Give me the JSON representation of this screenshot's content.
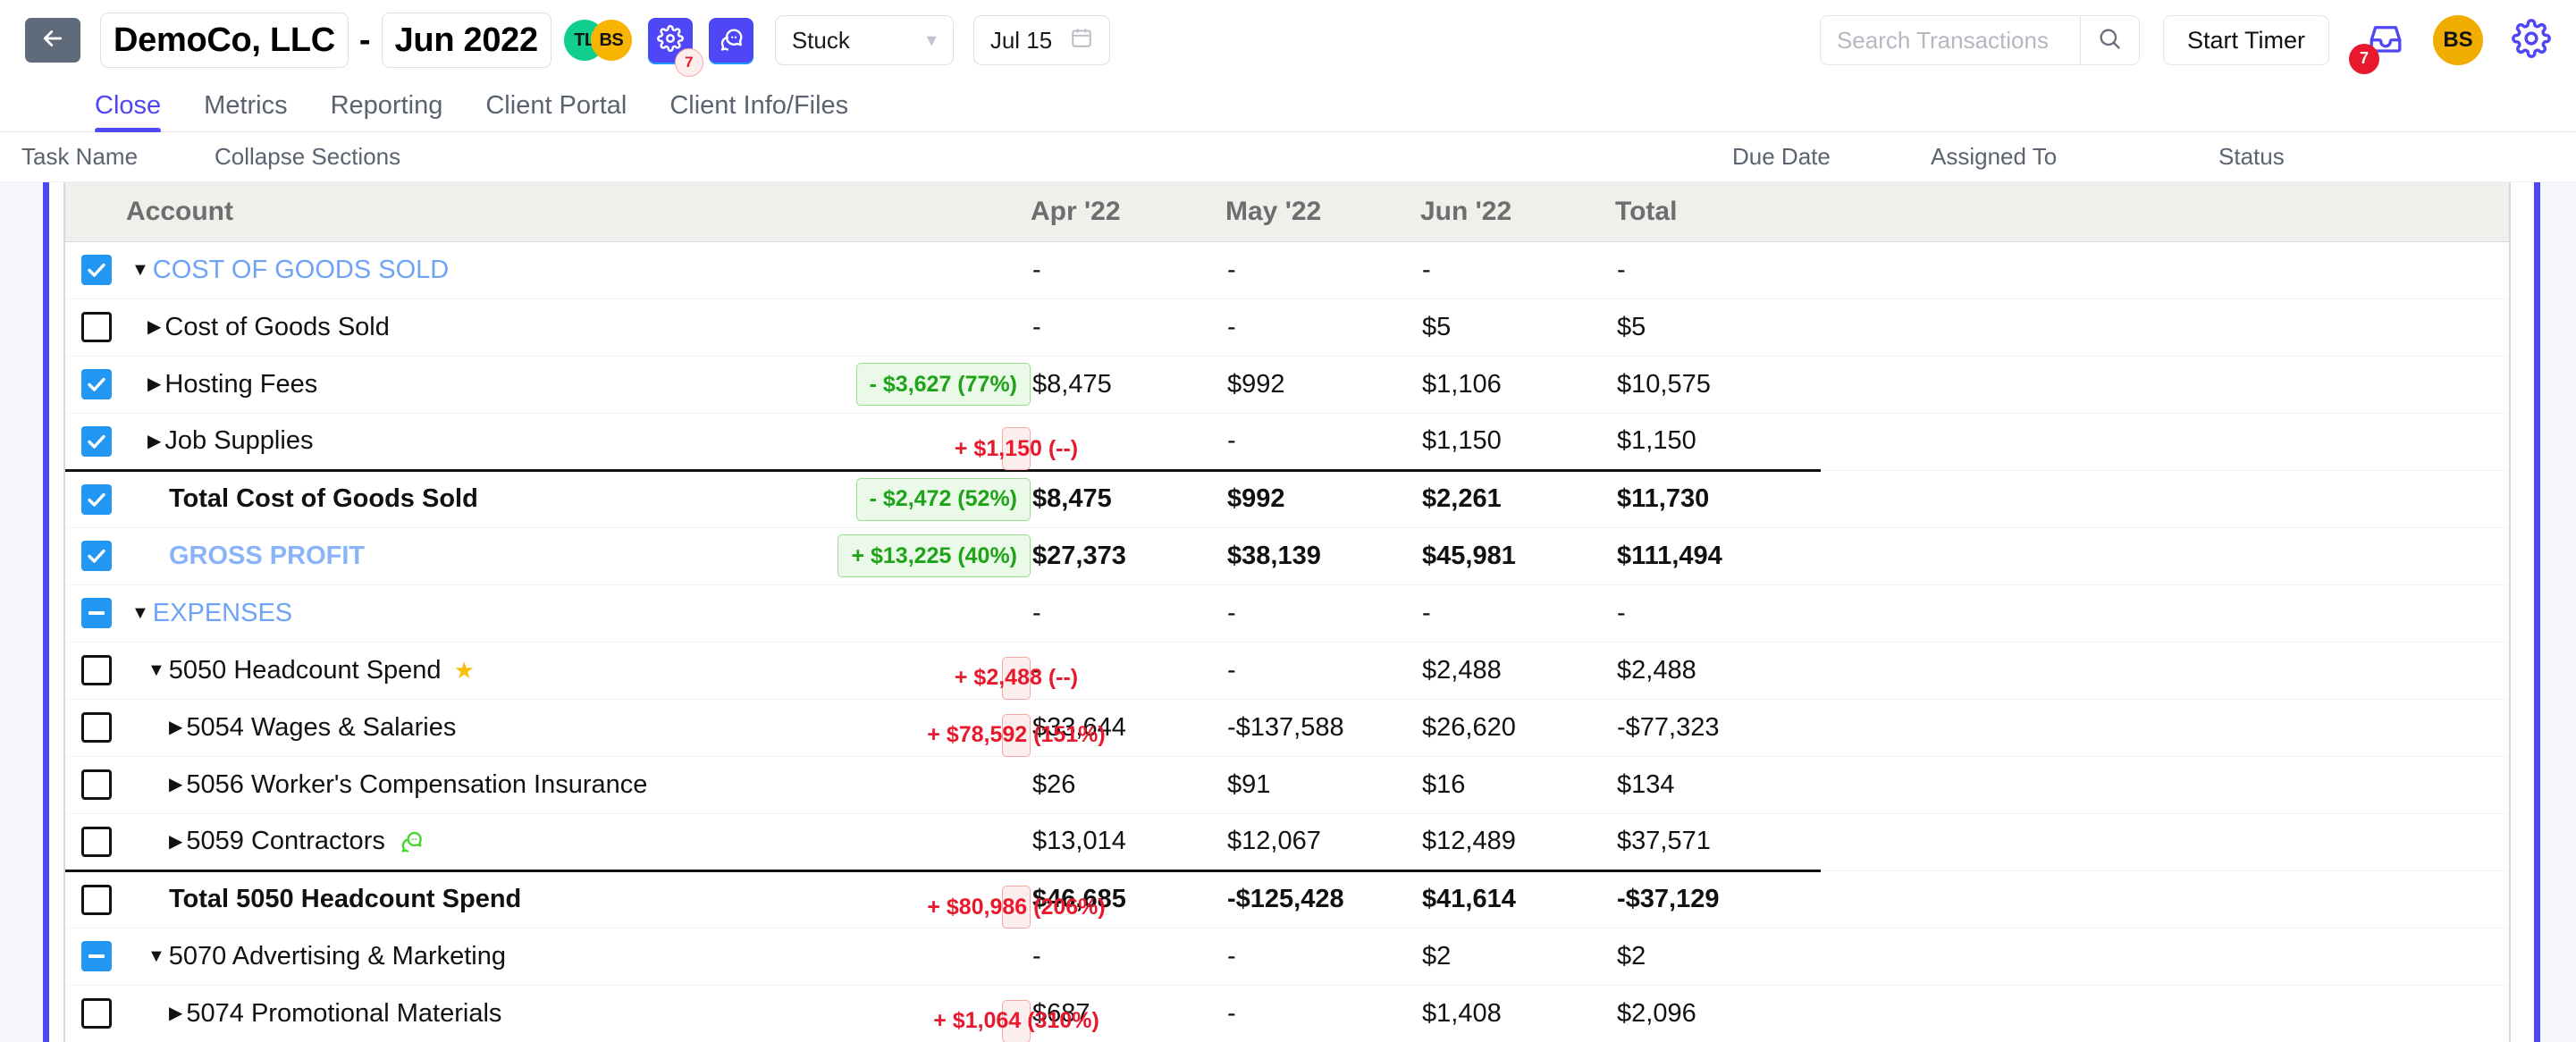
{
  "header": {
    "back_icon": "arrow-left-icon",
    "client_name": "DemoCo, LLC",
    "separator": "-",
    "period": "Jun 2022",
    "avatar_team": "TL",
    "avatar_team2": "BS",
    "gear_icon": "gear-icon",
    "chat_icon": "chat-bubble-icon",
    "chat_badge": "7",
    "status_select": "Stuck",
    "status_caret": "chevron-down-icon",
    "date_value": "Jul 15",
    "calendar_icon": "calendar-icon",
    "search_placeholder": "Search Transactions",
    "search_value": "",
    "search_icon": "search-icon",
    "start_timer": "Start Timer",
    "inbox_icon": "inbox-icon",
    "inbox_badge": "7",
    "user_avatar": "BS",
    "settings_icon": "gear-icon"
  },
  "tabs": [
    {
      "label": "Close",
      "active": true
    },
    {
      "label": "Metrics",
      "active": false
    },
    {
      "label": "Reporting",
      "active": false
    },
    {
      "label": "Client Portal",
      "active": false
    },
    {
      "label": "Client Info/Files",
      "active": false
    }
  ],
  "subheader": {
    "task_name": "Task Name",
    "collapse_sections": "Collapse Sections",
    "due_date": "Due Date",
    "assigned_to": "Assigned To",
    "status": "Status"
  },
  "table": {
    "columns": [
      "Account",
      "Apr '22",
      "May '22",
      "Jun '22",
      "Total"
    ],
    "rows": [
      {
        "checkbox": "checked",
        "indent": 0,
        "caret": "down",
        "label": "COST OF GOODS SOLD",
        "style": "section",
        "badge": null,
        "badge_type": null,
        "values": [
          "-",
          "-",
          "-",
          "-"
        ],
        "bold": false
      },
      {
        "checkbox": "unchecked",
        "indent": 1,
        "caret": "right",
        "label": "Cost of Goods Sold",
        "style": "normal",
        "badge": null,
        "badge_type": null,
        "values": [
          "-",
          "-",
          "$5",
          "$5"
        ],
        "bold": false
      },
      {
        "checkbox": "checked",
        "indent": 1,
        "caret": "right",
        "label": "Hosting Fees",
        "style": "normal",
        "badge": "- $3,627 (77%)",
        "badge_type": "green",
        "values": [
          "$8,475",
          "$992",
          "$1,106",
          "$10,575"
        ],
        "bold": false
      },
      {
        "checkbox": "checked",
        "indent": 1,
        "caret": "right",
        "label": "Job Supplies",
        "style": "normal",
        "badge": "+ $1,150 (--)",
        "badge_type": "red",
        "values": [
          "-",
          "-",
          "$1,150",
          "$1,150"
        ],
        "bold": false
      },
      {
        "checkbox": "checked",
        "indent": 2,
        "caret": null,
        "label": "Total Cost of Goods Sold",
        "style": "normal",
        "badge": "- $2,472 (52%)",
        "badge_type": "green",
        "values": [
          "$8,475",
          "$992",
          "$2,261",
          "$11,730"
        ],
        "bold": true,
        "topline": true
      },
      {
        "checkbox": "checked",
        "indent": 0,
        "caret": null,
        "label": "GROSS PROFIT",
        "style": "blue",
        "badge": "+ $13,225 (40%)",
        "badge_type": "green",
        "values": [
          "$27,373",
          "$38,139",
          "$45,981",
          "$111,494"
        ],
        "bold": true
      },
      {
        "checkbox": "indeterminate",
        "indent": 0,
        "caret": "down",
        "label": "EXPENSES",
        "style": "section",
        "badge": null,
        "badge_type": null,
        "values": [
          "-",
          "-",
          "-",
          "-"
        ],
        "bold": false
      },
      {
        "checkbox": "unchecked",
        "indent": 1,
        "caret": "down",
        "label": "5050 Headcount Spend",
        "style": "normal",
        "icon": "star-icon",
        "badge": "+ $2,488 (--)",
        "badge_type": "red",
        "values": [
          "-",
          "-",
          "$2,488",
          "$2,488"
        ],
        "bold": false
      },
      {
        "checkbox": "unchecked",
        "indent": 2,
        "caret": "right",
        "label": "5054 Wages & Salaries",
        "style": "normal",
        "badge": "+ $78,592 (151%)",
        "badge_type": "red",
        "values": [
          "$33,644",
          "-$137,588",
          "$26,620",
          "-$77,323"
        ],
        "bold": false
      },
      {
        "checkbox": "unchecked",
        "indent": 2,
        "caret": "right",
        "label": "5056 Worker's Compensation Insurance",
        "style": "normal",
        "badge": null,
        "badge_type": null,
        "values": [
          "$26",
          "$91",
          "$16",
          "$134"
        ],
        "bold": false
      },
      {
        "checkbox": "unchecked",
        "indent": 2,
        "caret": "right",
        "label": "5059 Contractors",
        "style": "normal",
        "icon": "chat-bubble-icon",
        "badge": null,
        "badge_type": null,
        "values": [
          "$13,014",
          "$12,067",
          "$12,489",
          "$37,571"
        ],
        "bold": false
      },
      {
        "checkbox": "unchecked",
        "indent": 2,
        "caret": null,
        "label": "Total 5050 Headcount Spend",
        "style": "normal",
        "badge": "+ $80,986 (206%)",
        "badge_type": "red",
        "values": [
          "$46,685",
          "-$125,428",
          "$41,614",
          "-$37,129"
        ],
        "bold": true,
        "topline": true
      },
      {
        "checkbox": "indeterminate",
        "indent": 1,
        "caret": "down",
        "label": "5070 Advertising & Marketing",
        "style": "normal",
        "badge": null,
        "badge_type": null,
        "values": [
          "-",
          "-",
          "$2",
          "$2"
        ],
        "bold": false
      },
      {
        "checkbox": "unchecked",
        "indent": 2,
        "caret": "right",
        "label": "5074 Promotional Materials",
        "style": "normal",
        "badge": "+ $1,064 (310%)",
        "badge_type": "red",
        "values": [
          "$687",
          "-",
          "$1,408",
          "$2,096"
        ],
        "bold": false
      }
    ]
  },
  "colors": {
    "accent": "#4f46f5",
    "checkbox_on": "#2196f3",
    "section_text": "#6fa3f7",
    "positive_badge": "#1fa318",
    "negative_badge": "#e8192c",
    "badge_red_border": "#f5a8a8",
    "badge_green_border": "#9bdb92",
    "avatar_green": "#10cf8c",
    "avatar_orange": "#f0ad00",
    "star": "#fbbd08",
    "chat_green": "#44d62c"
  }
}
